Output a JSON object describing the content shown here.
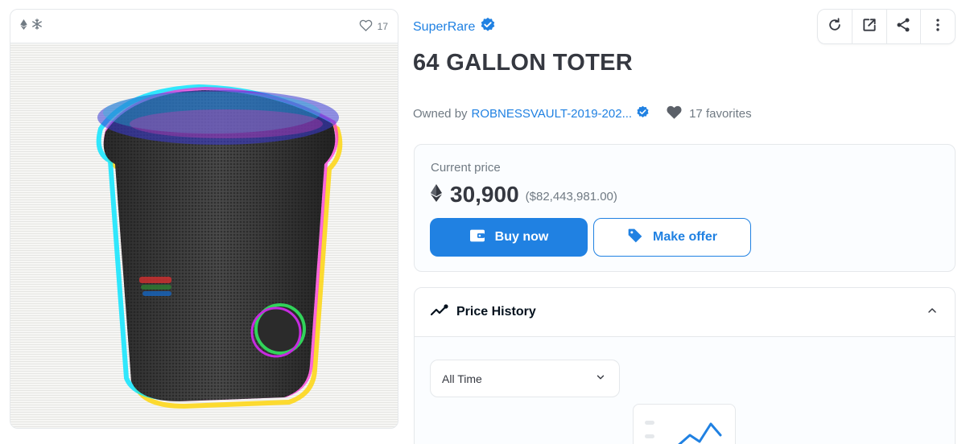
{
  "media": {
    "favorites_count": "17",
    "icons": [
      "ethereum-icon",
      "snowflake-icon",
      "heart-outline-icon"
    ]
  },
  "collection": {
    "name": "SuperRare",
    "verified_icon": "verified-badge-icon"
  },
  "toolbar": {
    "icons": [
      "refresh-icon",
      "external-link-icon",
      "share-icon",
      "more-vertical-icon"
    ]
  },
  "item": {
    "title": "64 GALLON TOTER"
  },
  "owner": {
    "prefix": "Owned by",
    "name": "ROBNESSVAULT-2019-202...",
    "favorites": "17 favorites"
  },
  "price": {
    "label": "Current price",
    "amount": "30,900",
    "usd": "($82,443,981.00)",
    "currency_icon": "ethereum-icon"
  },
  "actions": {
    "buy_label": "Buy now",
    "offer_label": "Make offer"
  },
  "history": {
    "title": "Price History",
    "range_selected": "All Time"
  },
  "colors": {
    "accent": "#2081e2",
    "text": "#353840",
    "muted": "#707a83",
    "border": "#e5e8eb"
  }
}
